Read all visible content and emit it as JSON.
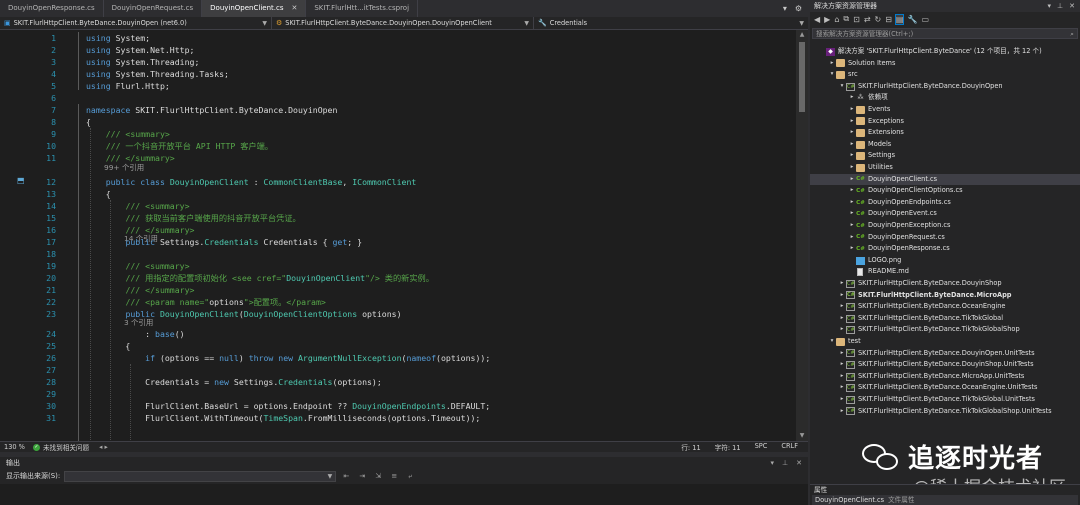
{
  "tabs": [
    {
      "label": "DouyinOpenResponse.cs",
      "active": false
    },
    {
      "label": "DouyinOpenRequest.cs",
      "active": false
    },
    {
      "label": "DouyinOpenClient.cs",
      "active": true
    },
    {
      "label": "SKIT.FlurlHtt...itTests.csproj",
      "active": false
    }
  ],
  "navbar": {
    "project": "SKIT.FlurlHttpClient.ByteDance.DouyinOpen (net6.0)",
    "type": "SKIT.FlurlHttpClient.ByteDance.DouyinOpen.DouyinOpenClient",
    "member": "Credentials"
  },
  "code_lines": [
    {
      "n": "1",
      "html": "<span class=\"kw\">using</span> System;"
    },
    {
      "n": "2",
      "html": "<span class=\"kw\">using</span> System.Net.Http;"
    },
    {
      "n": "3",
      "html": "<span class=\"kw\">using</span> System.Threading;"
    },
    {
      "n": "4",
      "html": "<span class=\"kw\">using</span> System.Threading.Tasks;"
    },
    {
      "n": "5",
      "html": "<span class=\"kw\">using</span> Flurl.Http;"
    },
    {
      "n": "6",
      "html": ""
    },
    {
      "n": "7",
      "html": "<span class=\"kw\">namespace</span> SKIT.FlurlHttpClient.ByteDance.DouyinOpen"
    },
    {
      "n": "8",
      "html": "{"
    },
    {
      "n": "9",
      "html": "    <span class=\"cm\">/// &lt;summary&gt;</span>"
    },
    {
      "n": "10",
      "html": "    <span class=\"cm\">/// 一个抖音开放平台 API HTTP 客户端。</span>"
    },
    {
      "n": "11",
      "html": "    <span class=\"cm\">/// &lt;/summary&gt;</span>"
    },
    {
      "n": "12",
      "html": "    <span class=\"kw\">public class</span> <span class=\"ty\">DouyinOpenClient</span> : <span class=\"ty\">CommonClientBase</span>, <span class=\"ty\">ICommonClient</span>"
    },
    {
      "n": "13",
      "html": "    {"
    },
    {
      "n": "14",
      "html": "        <span class=\"cm\">/// &lt;summary&gt;</span>"
    },
    {
      "n": "15",
      "html": "        <span class=\"cm\">/// 获取当前客户端使用的抖音开放平台凭证。</span>"
    },
    {
      "n": "16",
      "html": "        <span class=\"cm\">/// &lt;/summary&gt;</span>"
    },
    {
      "n": "17",
      "html": "        <span class=\"kw\">public</span> Settings.<span class=\"ty\">Credentials</span> Credentials { <span class=\"kw\">get</span>; }"
    },
    {
      "n": "18",
      "html": ""
    },
    {
      "n": "19",
      "html": "        <span class=\"cm\">/// &lt;summary&gt;</span>"
    },
    {
      "n": "20",
      "html": "        <span class=\"cm\">/// 用指定的配置项初始化 &lt;see cref=\"</span><span class=\"ty\">DouyinOpenClient</span><span class=\"cm\">\"/&gt; 类的新实例。</span>"
    },
    {
      "n": "21",
      "html": "        <span class=\"cm\">/// &lt;/summary&gt;</span>"
    },
    {
      "n": "22",
      "html": "        <span class=\"cm\">/// &lt;param name=\"</span>options<span class=\"cm\">\"&gt;配置项。&lt;/param&gt;</span>"
    },
    {
      "n": "23",
      "html": "        <span class=\"kw\">public</span> <span class=\"ty\">DouyinOpenClient</span>(<span class=\"ty\">DouyinOpenClientOptions</span> options)"
    },
    {
      "n": "24",
      "html": "            : <span class=\"kw\">base</span>()"
    },
    {
      "n": "25",
      "html": "        {"
    },
    {
      "n": "26",
      "html": "            <span class=\"kw\">if</span> (options == <span class=\"kw\">null</span>) <span class=\"kw\">throw new</span> <span class=\"ty\">ArgumentNullException</span>(<span class=\"kw\">nameof</span>(options));"
    },
    {
      "n": "27",
      "html": ""
    },
    {
      "n": "28",
      "html": "            Credentials = <span class=\"kw\">new</span> Settings.<span class=\"ty\">Credentials</span>(options);"
    },
    {
      "n": "29",
      "html": ""
    },
    {
      "n": "30",
      "html": "            FlurlClient.BaseUrl = options.Endpoint ?? <span class=\"ty\">DouyinOpenEndpoints</span>.DEFAULT;"
    },
    {
      "n": "31",
      "html": "            FlurlClient.WithTimeout(<span class=\"ty\">TimeSpan</span>.FromMilliseconds(options.Timeout));"
    }
  ],
  "codelens": [
    "99+ 个引用",
    "14 个引用",
    "3 个引用"
  ],
  "editor_status": {
    "zoom": "130 %",
    "issues": "未找到相关问题",
    "line": "行: 11",
    "char": "字符: 11",
    "spc": "SPC",
    "eol": "CRLF"
  },
  "output": {
    "title": "输出",
    "source_label": "显示输出来源(S):",
    "source_value": ""
  },
  "solution_explorer": {
    "title": "解决方案资源管理器",
    "search_placeholder": "搜索解决方案资源管理器(Ctrl+;)",
    "items": [
      {
        "label": "解决方案 'SKIT.FlurlHttpClient.ByteDance' (12 个项目，共 12 个)",
        "depth": 0,
        "exp": "",
        "icon": "sln",
        "bold": false,
        "sel": false
      },
      {
        "label": "Solution Items",
        "depth": 1,
        "exp": "▸",
        "icon": "folder",
        "bold": false,
        "sel": false
      },
      {
        "label": "src",
        "depth": 1,
        "exp": "▾",
        "icon": "folder",
        "bold": false,
        "sel": false
      },
      {
        "label": "SKIT.FlurlHttpClient.ByteDance.DouyinOpen",
        "depth": 2,
        "exp": "▾",
        "icon": "proj",
        "bold": false,
        "sel": false
      },
      {
        "label": "依赖项",
        "depth": 3,
        "exp": "▸",
        "icon": "dep",
        "bold": false,
        "sel": false
      },
      {
        "label": "Events",
        "depth": 3,
        "exp": "▸",
        "icon": "folder",
        "bold": false,
        "sel": false
      },
      {
        "label": "Exceptions",
        "depth": 3,
        "exp": "▸",
        "icon": "folder",
        "bold": false,
        "sel": false
      },
      {
        "label": "Extensions",
        "depth": 3,
        "exp": "▸",
        "icon": "folder",
        "bold": false,
        "sel": false
      },
      {
        "label": "Models",
        "depth": 3,
        "exp": "▸",
        "icon": "folder",
        "bold": false,
        "sel": false
      },
      {
        "label": "Settings",
        "depth": 3,
        "exp": "▸",
        "icon": "folder",
        "bold": false,
        "sel": false
      },
      {
        "label": "Utilities",
        "depth": 3,
        "exp": "▸",
        "icon": "folder",
        "bold": false,
        "sel": false
      },
      {
        "label": "DouyinOpenClient.cs",
        "depth": 3,
        "exp": "▸",
        "icon": "cs",
        "bold": false,
        "sel": true
      },
      {
        "label": "DouyinOpenClientOptions.cs",
        "depth": 3,
        "exp": "▸",
        "icon": "cs",
        "bold": false,
        "sel": false
      },
      {
        "label": "DouyinOpenEndpoints.cs",
        "depth": 3,
        "exp": "▸",
        "icon": "cs",
        "bold": false,
        "sel": false
      },
      {
        "label": "DouyinOpenEvent.cs",
        "depth": 3,
        "exp": "▸",
        "icon": "cs",
        "bold": false,
        "sel": false
      },
      {
        "label": "DouyinOpenException.cs",
        "depth": 3,
        "exp": "▸",
        "icon": "cs",
        "bold": false,
        "sel": false
      },
      {
        "label": "DouyinOpenRequest.cs",
        "depth": 3,
        "exp": "▸",
        "icon": "cs",
        "bold": false,
        "sel": false
      },
      {
        "label": "DouyinOpenResponse.cs",
        "depth": 3,
        "exp": "▸",
        "icon": "cs",
        "bold": false,
        "sel": false
      },
      {
        "label": "LOGO.png",
        "depth": 3,
        "exp": "",
        "icon": "img",
        "bold": false,
        "sel": false
      },
      {
        "label": "README.md",
        "depth": 3,
        "exp": "",
        "icon": "file",
        "bold": false,
        "sel": false
      },
      {
        "label": "SKIT.FlurlHttpClient.ByteDance.DouyinShop",
        "depth": 2,
        "exp": "▸",
        "icon": "proj",
        "bold": false,
        "sel": false
      },
      {
        "label": "SKIT.FlurlHttpClient.ByteDance.MicroApp",
        "depth": 2,
        "exp": "▸",
        "icon": "proj",
        "bold": true,
        "sel": false
      },
      {
        "label": "SKIT.FlurlHttpClient.ByteDance.OceanEngine",
        "depth": 2,
        "exp": "▸",
        "icon": "proj",
        "bold": false,
        "sel": false
      },
      {
        "label": "SKIT.FlurlHttpClient.ByteDance.TikTokGlobal",
        "depth": 2,
        "exp": "▸",
        "icon": "proj",
        "bold": false,
        "sel": false
      },
      {
        "label": "SKIT.FlurlHttpClient.ByteDance.TikTokGlobalShop",
        "depth": 2,
        "exp": "▸",
        "icon": "proj",
        "bold": false,
        "sel": false
      },
      {
        "label": "test",
        "depth": 1,
        "exp": "▾",
        "icon": "folder",
        "bold": false,
        "sel": false
      },
      {
        "label": "SKIT.FlurlHttpClient.ByteDance.DouyinOpen.UnitTests",
        "depth": 2,
        "exp": "▸",
        "icon": "proj",
        "bold": false,
        "sel": false
      },
      {
        "label": "SKIT.FlurlHttpClient.ByteDance.DouyinShop.UnitTests",
        "depth": 2,
        "exp": "▸",
        "icon": "proj",
        "bold": false,
        "sel": false
      },
      {
        "label": "SKIT.FlurlHttpClient.ByteDance.MicroApp.UnitTests",
        "depth": 2,
        "exp": "▸",
        "icon": "proj",
        "bold": false,
        "sel": false
      },
      {
        "label": "SKIT.FlurlHttpClient.ByteDance.OceanEngine.UnitTests",
        "depth": 2,
        "exp": "▸",
        "icon": "proj",
        "bold": false,
        "sel": false
      },
      {
        "label": "SKIT.FlurlHttpClient.ByteDance.TikTokGlobal.UnitTests",
        "depth": 2,
        "exp": "▸",
        "icon": "proj",
        "bold": false,
        "sel": false
      },
      {
        "label": "SKIT.FlurlHttpClient.ByteDance.TikTokGlobalShop.UnitTests",
        "depth": 2,
        "exp": "▸",
        "icon": "proj",
        "bold": false,
        "sel": false
      }
    ]
  },
  "properties": {
    "title": "属性",
    "object": "DouyinOpenClient.cs",
    "object_kind": "文件属性"
  },
  "watermark": {
    "brand": "追逐时光者",
    "site": "@稀土掘金技术社区"
  },
  "colors": {
    "keyword": "#569cd6",
    "type": "#4ec9b0",
    "comment": "#57a64a",
    "line_number": "#2b91af",
    "accent": "#007acc"
  }
}
